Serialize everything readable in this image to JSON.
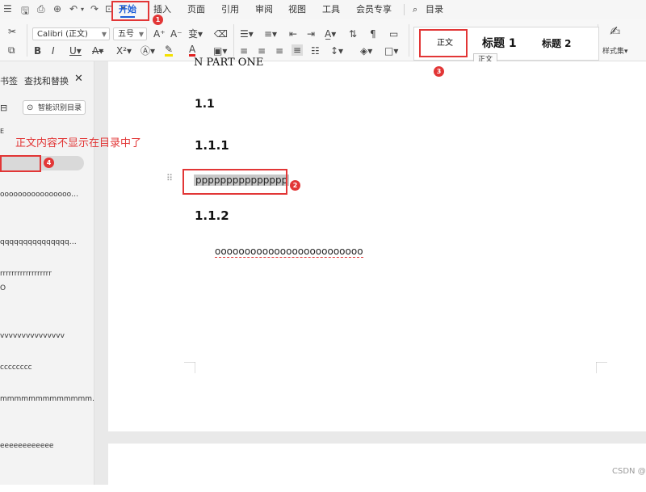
{
  "menubar": {
    "tabs": [
      "开始",
      "插入",
      "页面",
      "引用",
      "审阅",
      "视图",
      "工具",
      "会员专享"
    ],
    "search_label": "目录"
  },
  "ribbon": {
    "font_name": "Calibri (正文)",
    "font_size": "五号",
    "styles_label": "样式集",
    "style_gallery": [
      "正文",
      "标题 1",
      "标题 2"
    ]
  },
  "tooltip": "正文",
  "nav": {
    "tab_bookmarks": "书签",
    "tab_find_replace": "查找和替换",
    "smart_toc_button": "智能识别目录",
    "items": [
      "E",
      "",
      "oooooooooooooooo…",
      "qqqqqqqqqqqqqqq…",
      "rrrrrrrrrrrrrrrrrr",
      "O",
      "vvvvvvvvvvvvvvv",
      "cccccccc",
      "mmmmmmmmmmmmm…",
      "eeeeeeeeeeee"
    ]
  },
  "annotation": {
    "note": "正文内容不显示在目录中了",
    "badges": [
      "1",
      "2",
      "3",
      "4"
    ]
  },
  "document": {
    "partial_title": "N PART ONE",
    "h1": "1.1",
    "h2a": "1.1.1",
    "para_selected": "ppppppppppppppp",
    "h2b": "1.1.2",
    "para": "ooooooooooooooooooooooooo"
  },
  "watermark": "CSDN @"
}
